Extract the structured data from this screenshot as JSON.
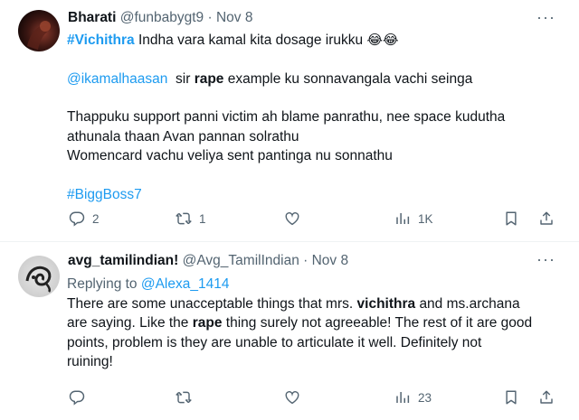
{
  "tweets": [
    {
      "display_name": "Bharati",
      "handle": "@funbabygt9",
      "separator": "·",
      "date": "Nov 8",
      "more": "···",
      "line1_hashtag": "#Vichithra",
      "line1_text": "Indha vara kamal kita dosage irukku",
      "line1_emoji": "😂😂",
      "line2_mention": "@ikamalhaasan",
      "line2_pre": "sir",
      "line2_bold": "rape",
      "line2_post": "example ku sonnavangala vachi seinga",
      "line3": "Thappuku support panni victim ah blame panrathu, nee space kudutha",
      "line4": "athunala thaan Avan pannan  solrathu",
      "line5": "Womencard vachu veliya sent pantinga nu sonnathu",
      "hashtag": "#BiggBoss7",
      "counts": {
        "replies": "2",
        "reposts": "1",
        "likes": "",
        "views": "1K"
      }
    },
    {
      "display_name": "avg_tamilindian!",
      "handle": "@Avg_TamilIndian",
      "separator": "·",
      "date": "Nov 8",
      "more": "···",
      "replying_label": "Replying to",
      "replying_handle": "@Alexa_1414",
      "l1_pre": "There are some unacceptable things that mrs.",
      "l1_bold": "vichithra",
      "l1_post": "and ms.archana",
      "l2_pre": "are saying. Like the",
      "l2_bold": "rape",
      "l2_post": "thing surely not agreeable! The rest of it are good",
      "l3": "points, problem is they are unable to articulate it well. Definitely not",
      "l4": "ruining!",
      "counts": {
        "replies": "",
        "reposts": "",
        "likes": "",
        "views": "23"
      }
    }
  ],
  "icons": [
    "reply-icon",
    "repost-icon",
    "like-icon",
    "views-icon",
    "bookmark-icon",
    "share-icon",
    "more-icon"
  ],
  "colors": {
    "link": "#1d9bf0",
    "muted": "#536471",
    "text": "#0f1419"
  }
}
